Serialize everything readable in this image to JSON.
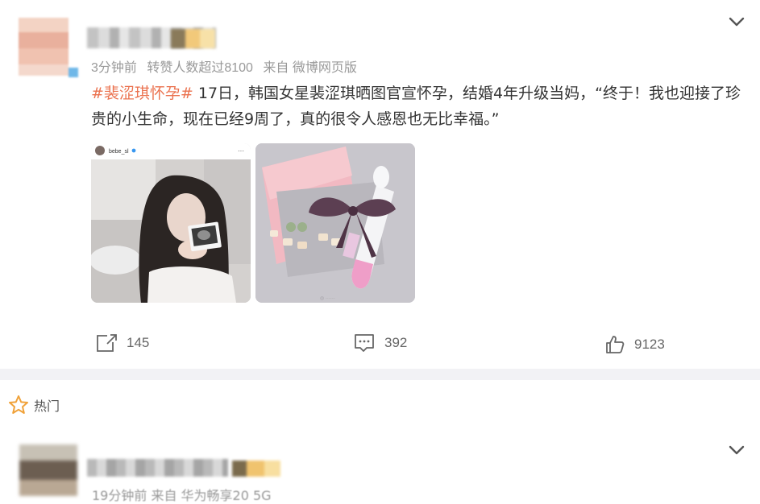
{
  "post": {
    "meta": {
      "time": "3分钟前",
      "reposts_note": "转赞人数超过8100",
      "source": "来自 微博网页版"
    },
    "content": {
      "hashtag": "#裴涩琪怀孕#",
      "text": " 17日，韩国女星裴涩琪晒图官宣怀孕，结婚4年升级当妈，“终于！我也迎接了珍贵的小生命，现在已经9周了，真的很令人感恩也无比幸福。”"
    },
    "images": [
      {
        "username": "bebe_sl",
        "menu": "···"
      },
      {
        "caption": "photo-2"
      }
    ],
    "actions": {
      "share_count": "145",
      "comment_count": "392",
      "like_count": "9123"
    },
    "icons": {
      "share": "share-icon",
      "comment": "comment-icon",
      "like": "thumbs-up-icon",
      "more": "chevron-down-icon"
    }
  },
  "hot_section": {
    "label": "热门",
    "icon": "star-icon",
    "star_color": "#f0a23a"
  },
  "comment": {
    "meta": "19分钟前  来自 华为畅享20 5G"
  },
  "colors": {
    "hashtag": "#eb7350",
    "meta_gray": "#999999",
    "divider": "#f2f2f5"
  }
}
